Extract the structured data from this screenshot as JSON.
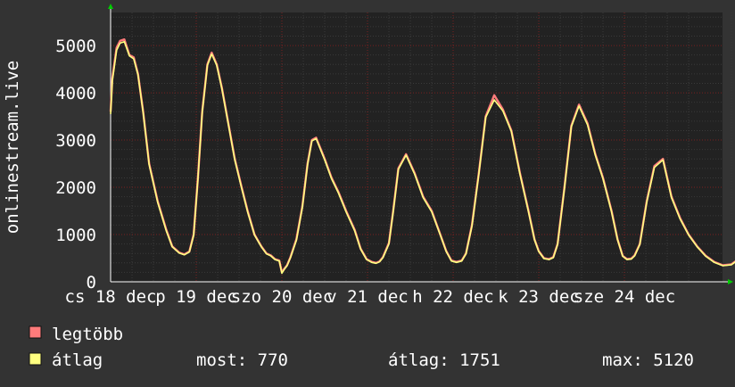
{
  "chart_data": {
    "type": "line",
    "title": "",
    "xlabel": "",
    "ylabel": "onlinestream.live",
    "ylim": [
      0,
      5700
    ],
    "yticks": [
      0,
      1000,
      2000,
      3000,
      4000,
      5000
    ],
    "xlim": [
      0,
      7.65
    ],
    "x_tick_labels": [
      {
        "day": 0.0,
        "label": "cs 18 dec"
      },
      {
        "day": 1.0,
        "label": "p 19 dec"
      },
      {
        "day": 2.0,
        "label": "szo 20 dec"
      },
      {
        "day": 3.0,
        "label": "v 21 dec"
      },
      {
        "day": 4.0,
        "label": "h 22 dec"
      },
      {
        "day": 5.0,
        "label": "k 23 dec"
      },
      {
        "day": 6.0,
        "label": "sze 24 dec"
      }
    ],
    "grid": true,
    "legend_position": "bottom-left",
    "series": [
      {
        "name": "legtöbb",
        "color": "#ff7b7b",
        "x": [
          0.0,
          0.02,
          0.07,
          0.11,
          0.16,
          0.22,
          0.27,
          0.32,
          0.38,
          0.45,
          0.55,
          0.65,
          0.72,
          0.8,
          0.86,
          0.92,
          0.97,
          1.02,
          1.07,
          1.13,
          1.18,
          1.24,
          1.3,
          1.38,
          1.45,
          1.53,
          1.6,
          1.68,
          1.76,
          1.82,
          1.87,
          1.92,
          1.97,
          2.0,
          2.03,
          2.06,
          2.1,
          2.17,
          2.24,
          2.3,
          2.35,
          2.4,
          2.5,
          2.58,
          2.66,
          2.75,
          2.85,
          2.92,
          2.99,
          3.05,
          3.1,
          3.14,
          3.18,
          3.25,
          3.3,
          3.36,
          3.45,
          3.55,
          3.65,
          3.75,
          3.85,
          3.92,
          3.98,
          4.04,
          4.1,
          4.15,
          4.22,
          4.3,
          4.38,
          4.48,
          4.58,
          4.68,
          4.78,
          4.88,
          4.95,
          5.0,
          5.06,
          5.12,
          5.17,
          5.22,
          5.3,
          5.38,
          5.47,
          5.57,
          5.66,
          5.75,
          5.85,
          5.92,
          5.98,
          6.03,
          6.08,
          6.12,
          6.18,
          6.26,
          6.35,
          6.45,
          6.55,
          6.65,
          6.75,
          6.85,
          6.95,
          7.05,
          7.15,
          7.25,
          7.35,
          7.45,
          7.55,
          7.62
        ],
        "y": [
          3600,
          4300,
          4950,
          5100,
          5130,
          4800,
          4750,
          4400,
          3600,
          2500,
          1700,
          1100,
          750,
          620,
          580,
          640,
          1000,
          2200,
          3600,
          4600,
          4850,
          4600,
          4100,
          3300,
          2600,
          2000,
          1500,
          1000,
          750,
          600,
          560,
          480,
          450,
          200,
          280,
          350,
          520,
          900,
          1600,
          2500,
          3000,
          3050,
          2600,
          2200,
          1900,
          1500,
          1100,
          700,
          480,
          420,
          400,
          430,
          520,
          820,
          1500,
          2400,
          2700,
          2300,
          1800,
          1500,
          1000,
          650,
          450,
          420,
          450,
          600,
          1200,
          2300,
          3500,
          3950,
          3650,
          3200,
          2300,
          1500,
          900,
          650,
          500,
          480,
          520,
          800,
          2000,
          3300,
          3750,
          3350,
          2700,
          2200,
          1500,
          900,
          550,
          480,
          490,
          560,
          800,
          1700,
          2450,
          2600,
          1800,
          1350,
          1000,
          750,
          550,
          420,
          350,
          370,
          500,
          620,
          780,
          800
        ]
      },
      {
        "name": "átlag",
        "color": "#ffff80",
        "x": [
          0.0,
          0.02,
          0.07,
          0.11,
          0.16,
          0.22,
          0.27,
          0.32,
          0.38,
          0.45,
          0.55,
          0.65,
          0.72,
          0.8,
          0.86,
          0.92,
          0.97,
          1.02,
          1.07,
          1.13,
          1.18,
          1.24,
          1.3,
          1.38,
          1.45,
          1.53,
          1.6,
          1.68,
          1.76,
          1.82,
          1.87,
          1.92,
          1.97,
          2.0,
          2.03,
          2.06,
          2.1,
          2.17,
          2.24,
          2.3,
          2.35,
          2.4,
          2.5,
          2.58,
          2.66,
          2.75,
          2.85,
          2.92,
          2.99,
          3.05,
          3.1,
          3.14,
          3.18,
          3.25,
          3.3,
          3.36,
          3.45,
          3.55,
          3.65,
          3.75,
          3.85,
          3.92,
          3.98,
          4.04,
          4.1,
          4.15,
          4.22,
          4.3,
          4.38,
          4.48,
          4.58,
          4.68,
          4.78,
          4.88,
          4.95,
          5.0,
          5.06,
          5.12,
          5.17,
          5.22,
          5.3,
          5.38,
          5.47,
          5.57,
          5.66,
          5.75,
          5.85,
          5.92,
          5.98,
          6.03,
          6.08,
          6.12,
          6.18,
          6.26,
          6.35,
          6.45,
          6.55,
          6.65,
          6.75,
          6.85,
          6.95,
          7.05,
          7.15,
          7.25,
          7.35,
          7.45,
          7.55,
          7.62
        ],
        "y": [
          3550,
          4250,
          4900,
          5050,
          5080,
          4780,
          4720,
          4380,
          3580,
          2480,
          1680,
          1080,
          740,
          610,
          570,
          630,
          980,
          2180,
          3580,
          4580,
          4820,
          4580,
          4080,
          3280,
          2580,
          1980,
          1480,
          990,
          740,
          590,
          550,
          470,
          440,
          180,
          270,
          340,
          510,
          880,
          1580,
          2480,
          2980,
          3030,
          2580,
          2180,
          1880,
          1480,
          1080,
          690,
          470,
          410,
          390,
          420,
          510,
          800,
          1480,
          2380,
          2680,
          2280,
          1780,
          1480,
          990,
          640,
          440,
          410,
          440,
          590,
          1180,
          2280,
          3480,
          3850,
          3620,
          3180,
          2280,
          1480,
          890,
          640,
          490,
          470,
          510,
          790,
          1980,
          3280,
          3720,
          3320,
          2680,
          2180,
          1480,
          890,
          540,
          470,
          480,
          550,
          790,
          1680,
          2420,
          2580,
          1780,
          1330,
          990,
          740,
          540,
          410,
          340,
          360,
          490,
          610,
          770,
          780
        ]
      }
    ]
  },
  "legend": [
    {
      "label": "legtöbb",
      "color": "#ff7b7b"
    },
    {
      "label": "átlag",
      "color": "#ffff80"
    }
  ],
  "stats": {
    "now": "most: 770",
    "avg": "átlag: 1751",
    "max": "max: 5120"
  },
  "colors": {
    "background": "#333333",
    "plot_background": "#222222",
    "grid_major": "#7a2020",
    "grid_minor": "#3a3a3a",
    "axis": "#ffffff",
    "text": "#ffffff",
    "arrow": "#00cc00"
  }
}
